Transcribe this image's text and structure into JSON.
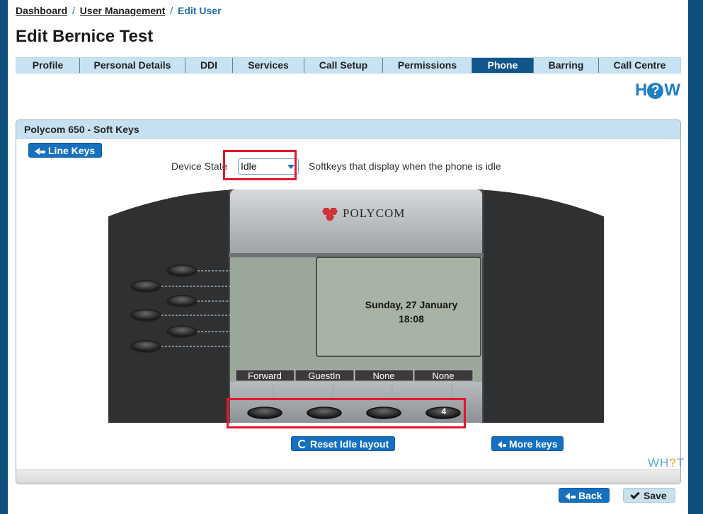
{
  "breadcrumb": {
    "items": [
      "Dashboard",
      "User Management"
    ],
    "separator": "/",
    "current": "Edit User"
  },
  "page_title": "Edit Bernice Test",
  "tabs": [
    {
      "label": "Profile",
      "active": false
    },
    {
      "label": "Personal Details",
      "active": false
    },
    {
      "label": "DDI",
      "active": false
    },
    {
      "label": "Services",
      "active": false
    },
    {
      "label": "Call Setup",
      "active": false
    },
    {
      "label": "Permissions",
      "active": false
    },
    {
      "label": "Phone",
      "active": true
    },
    {
      "label": "Barring",
      "active": false
    },
    {
      "label": "Call Centre",
      "active": false
    }
  ],
  "how_logo": {
    "left": "H",
    "middle": "?",
    "right": "W"
  },
  "panel": {
    "title": "Polycom 650 - Soft Keys",
    "line_keys_button": "Line Keys",
    "device_state_label": "Device State",
    "device_state_value": "Idle",
    "device_state_description": "Softkeys that display when the phone is idle",
    "phone": {
      "brand": "POLYCOM",
      "date": "Sunday, 27 January",
      "time": "18:08",
      "softkeys": [
        "Forward",
        "GuestIn",
        "None",
        "None"
      ],
      "key_badge": "4"
    },
    "reset_button": "Reset Idle layout",
    "more_keys_button": "More keys"
  },
  "what_logo": {
    "left": "WH",
    "middle": "?",
    "right": "T"
  },
  "footer": {
    "back_button": "Back",
    "save_button": "Save"
  },
  "colors": {
    "accent": "#1570c0",
    "tab_active": "#11558a",
    "highlight": "#e3162b",
    "frame": "#0d4f7a"
  }
}
